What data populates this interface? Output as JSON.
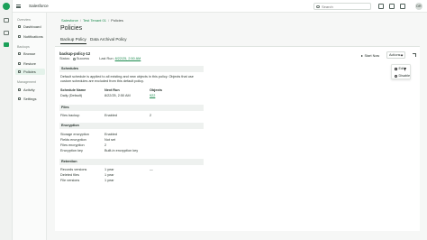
{
  "topbar": {
    "org_name": "Salesforce",
    "search_placeholder": "Search",
    "avatar_initials": "DR"
  },
  "sidenav": {
    "sections": [
      {
        "heading": "Overview",
        "items": [
          "Dashboard",
          "Notifications"
        ]
      },
      {
        "heading": "Backups",
        "items": [
          "Browse",
          "Restore",
          "Policies"
        ]
      },
      {
        "heading": "Management",
        "items": [
          "Activity",
          "Settings"
        ]
      }
    ],
    "active_item": "Policies"
  },
  "breadcrumb": [
    "Salesforce",
    "Test Tenant 01",
    "Policies"
  ],
  "page_title": "Policies",
  "tabs": [
    {
      "label": "Backup Policy",
      "active": true
    },
    {
      "label": "Data Archival Policy",
      "active": false
    }
  ],
  "policy": {
    "name": "backup-policy-12",
    "status_label": "Status:",
    "status_value": "Success",
    "last_run_label": "Last Run:",
    "last_run_value": "8/22/25, 2:50 AM"
  },
  "toolbar": {
    "start_now": "Start Now",
    "actions": "Actions"
  },
  "actions_menu": [
    "Edit",
    "Disable"
  ],
  "schedules": {
    "heading": "Schedules",
    "description": "Default schedule is applied to all existing and new objects in this policy. Objects that use custom schedules are excluded from this default policy.",
    "columns": [
      "Schedule Name",
      "Next Run",
      "Objects"
    ],
    "rows": [
      {
        "name": "Daily (Default)",
        "next_run": "8/22/25, 2:50 AM",
        "objects": "922"
      }
    ]
  },
  "files": {
    "heading": "Files",
    "rows": [
      {
        "label": "Files backup",
        "value": "Enabled",
        "extra": "2"
      }
    ]
  },
  "encryption": {
    "heading": "Encryption",
    "rows": [
      {
        "label": "Storage encryption",
        "value": "Enabled"
      },
      {
        "label": "Fields encryption",
        "value": "Not set"
      },
      {
        "label": "Files encryption",
        "value": "2"
      },
      {
        "label": "Encryption key",
        "value": "Built-in encryption key"
      }
    ]
  },
  "retention": {
    "heading": "Retention",
    "rows": [
      {
        "label": "Records versions",
        "value": "1 year",
        "extra": "—"
      },
      {
        "label": "Deleted files",
        "value": "1 year"
      },
      {
        "label": "File versions",
        "value": "1 year"
      }
    ]
  },
  "colors": {
    "brand": "#1aa058",
    "link": "#1a8a4c",
    "active_nav_bg": "#e4f2ea"
  }
}
